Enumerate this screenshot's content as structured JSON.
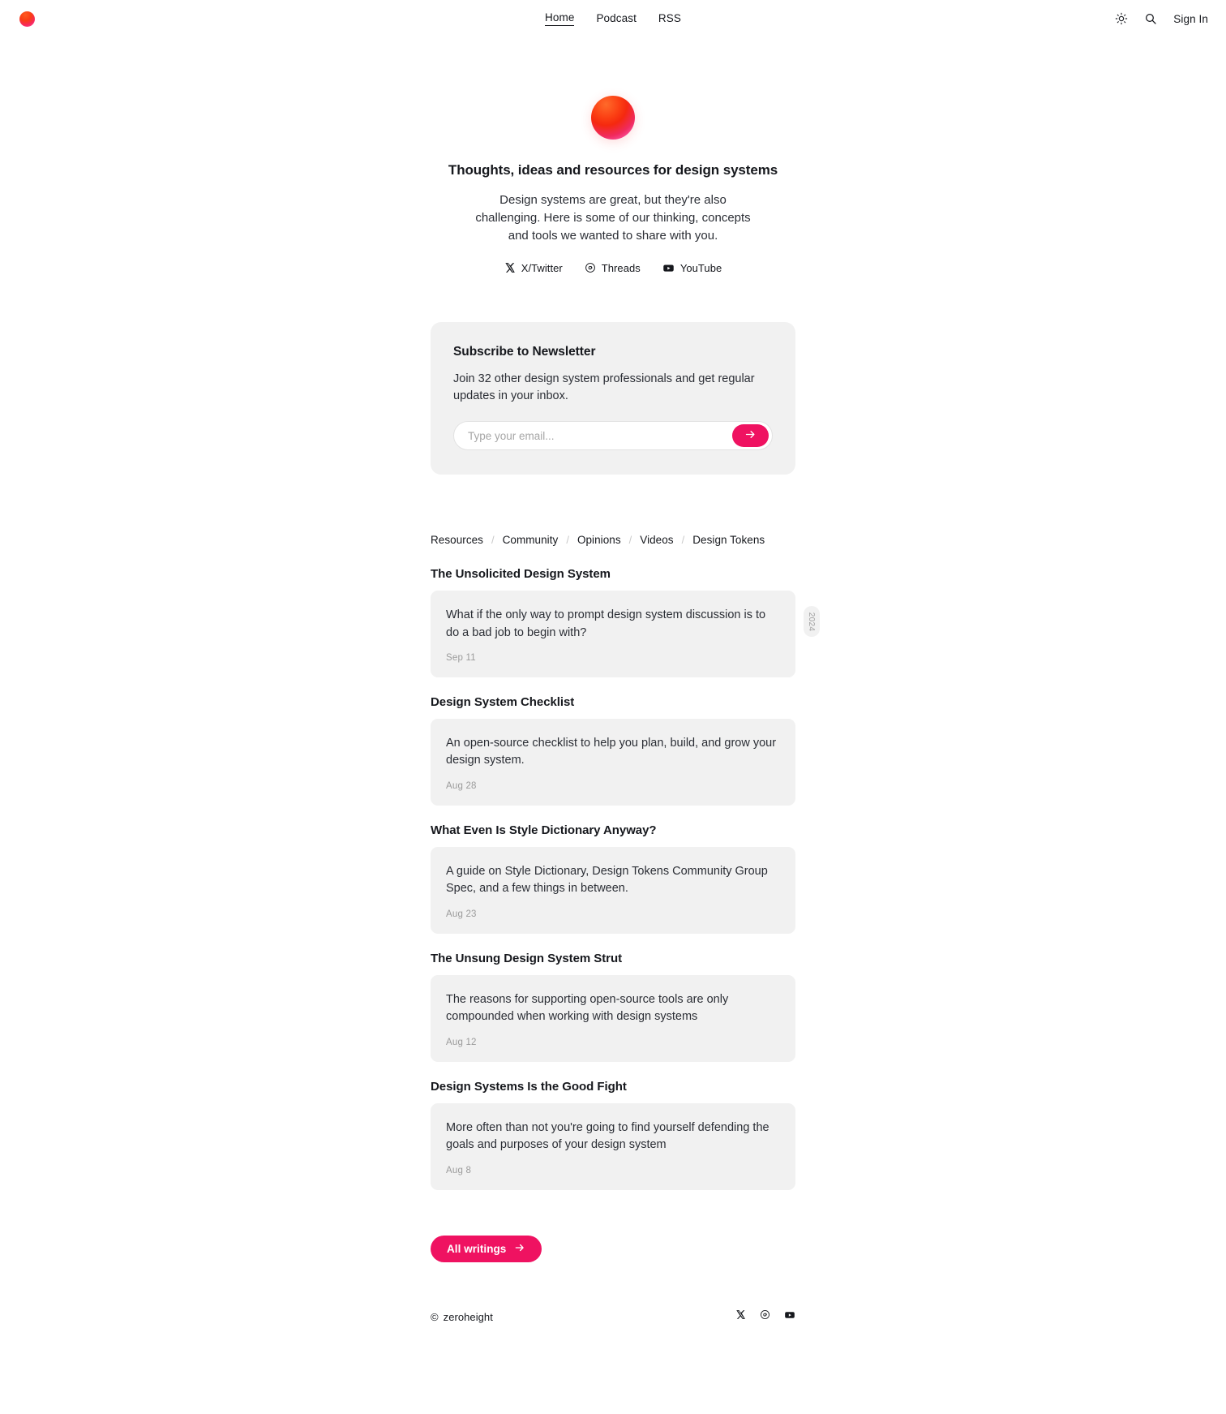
{
  "nav": {
    "logo_name": "zeroheight-logo",
    "links": [
      {
        "label": "Home",
        "active": true
      },
      {
        "label": "Podcast",
        "active": false
      },
      {
        "label": "RSS",
        "active": false
      }
    ],
    "theme_toggle": "sun-icon",
    "search": "search-icon",
    "sign_in": "Sign In"
  },
  "hero": {
    "title": "Thoughts, ideas and resources for design systems",
    "description": "Design systems are great, but they're also challenging. Here is some of our thinking, concepts and tools we wanted to share with you.",
    "socials": [
      {
        "label": "X/Twitter",
        "icon": "x-twitter-icon"
      },
      {
        "label": "Threads",
        "icon": "threads-icon"
      },
      {
        "label": "YouTube",
        "icon": "youtube-icon"
      }
    ]
  },
  "newsletter": {
    "title": "Subscribe to Newsletter",
    "description": "Join 32 other design system professionals and get regular updates in your inbox.",
    "placeholder": "Type your email...",
    "value": "",
    "submit_icon": "arrow-right-icon",
    "accent_color": "#ef1261",
    "card_background": "#f1f1f1"
  },
  "categories": [
    {
      "label": "Resources"
    },
    {
      "label": "Community"
    },
    {
      "label": "Opinions"
    },
    {
      "label": "Videos"
    },
    {
      "label": "Design Tokens"
    }
  ],
  "category_separator": "/",
  "articles": [
    {
      "title": "The Unsolicited Design System",
      "excerpt": "What if the only way to prompt design system discussion is to do a bad job to begin with?",
      "date": "Sep 11",
      "year_badge": "2024"
    },
    {
      "title": "Design System Checklist",
      "excerpt": "An open-source checklist to help you plan, build, and grow your design system.",
      "date": "Aug 28",
      "year_badge": null
    },
    {
      "title": "What Even Is Style Dictionary Anyway?",
      "excerpt": "A guide on Style Dictionary, Design Tokens Community Group Spec, and a few things in between.",
      "date": "Aug 23",
      "year_badge": null
    },
    {
      "title": "The Unsung Design System Strut",
      "excerpt": "The reasons for supporting open-source tools are only compounded when working with design systems",
      "date": "Aug 12",
      "year_badge": null
    },
    {
      "title": "Design Systems Is the Good Fight",
      "excerpt": "More often than not you're going to find yourself defending the goals and purposes of your design system",
      "date": "Aug 8",
      "year_badge": null
    }
  ],
  "cta": {
    "label": "All writings",
    "icon": "arrow-right-icon"
  },
  "footer": {
    "copyright_symbol": "©",
    "copyright": "zeroheight",
    "socials": [
      {
        "icon": "x-twitter-icon"
      },
      {
        "icon": "threads-icon"
      },
      {
        "icon": "youtube-icon"
      }
    ]
  }
}
